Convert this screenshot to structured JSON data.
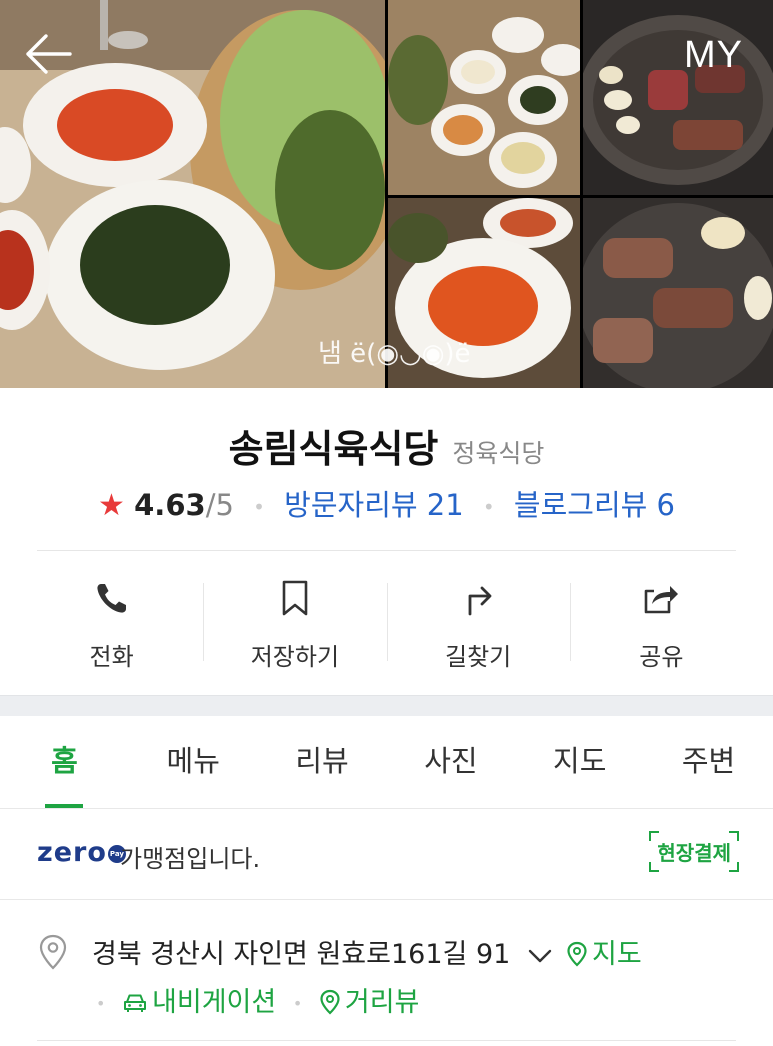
{
  "header": {
    "back_icon": "arrow-left-icon",
    "my_label": "MY"
  },
  "photos": {
    "watermark": "냄 ë(◉◡◉)ë"
  },
  "place": {
    "name": "송림식육식당",
    "category": "정육식당",
    "rating": "4.63",
    "rating_max": "/5",
    "visitor_reviews": "방문자리뷰 21",
    "blog_reviews": "블로그리뷰 6"
  },
  "actions": [
    {
      "label": "전화",
      "icon": "phone-icon"
    },
    {
      "label": "저장하기",
      "icon": "bookmark-icon"
    },
    {
      "label": "길찾기",
      "icon": "directions-icon"
    },
    {
      "label": "공유",
      "icon": "share-icon"
    }
  ],
  "tabs": [
    "홈",
    "메뉴",
    "리뷰",
    "사진",
    "지도",
    "주변"
  ],
  "active_tab": "홈",
  "zeropay": {
    "logo": "zero",
    "pay": "Pay",
    "text": "가맹점입니다.",
    "badge": "현장결제"
  },
  "address": {
    "text": "경북 경산시 자인면 원효로161길 91",
    "map": "지도",
    "navigation": "내비게이션",
    "street_view": "거리뷰"
  },
  "colors": {
    "green": "#1ea442",
    "blue": "#2664c8",
    "star": "#e83a3a",
    "zeropay": "#1f3c8a"
  }
}
